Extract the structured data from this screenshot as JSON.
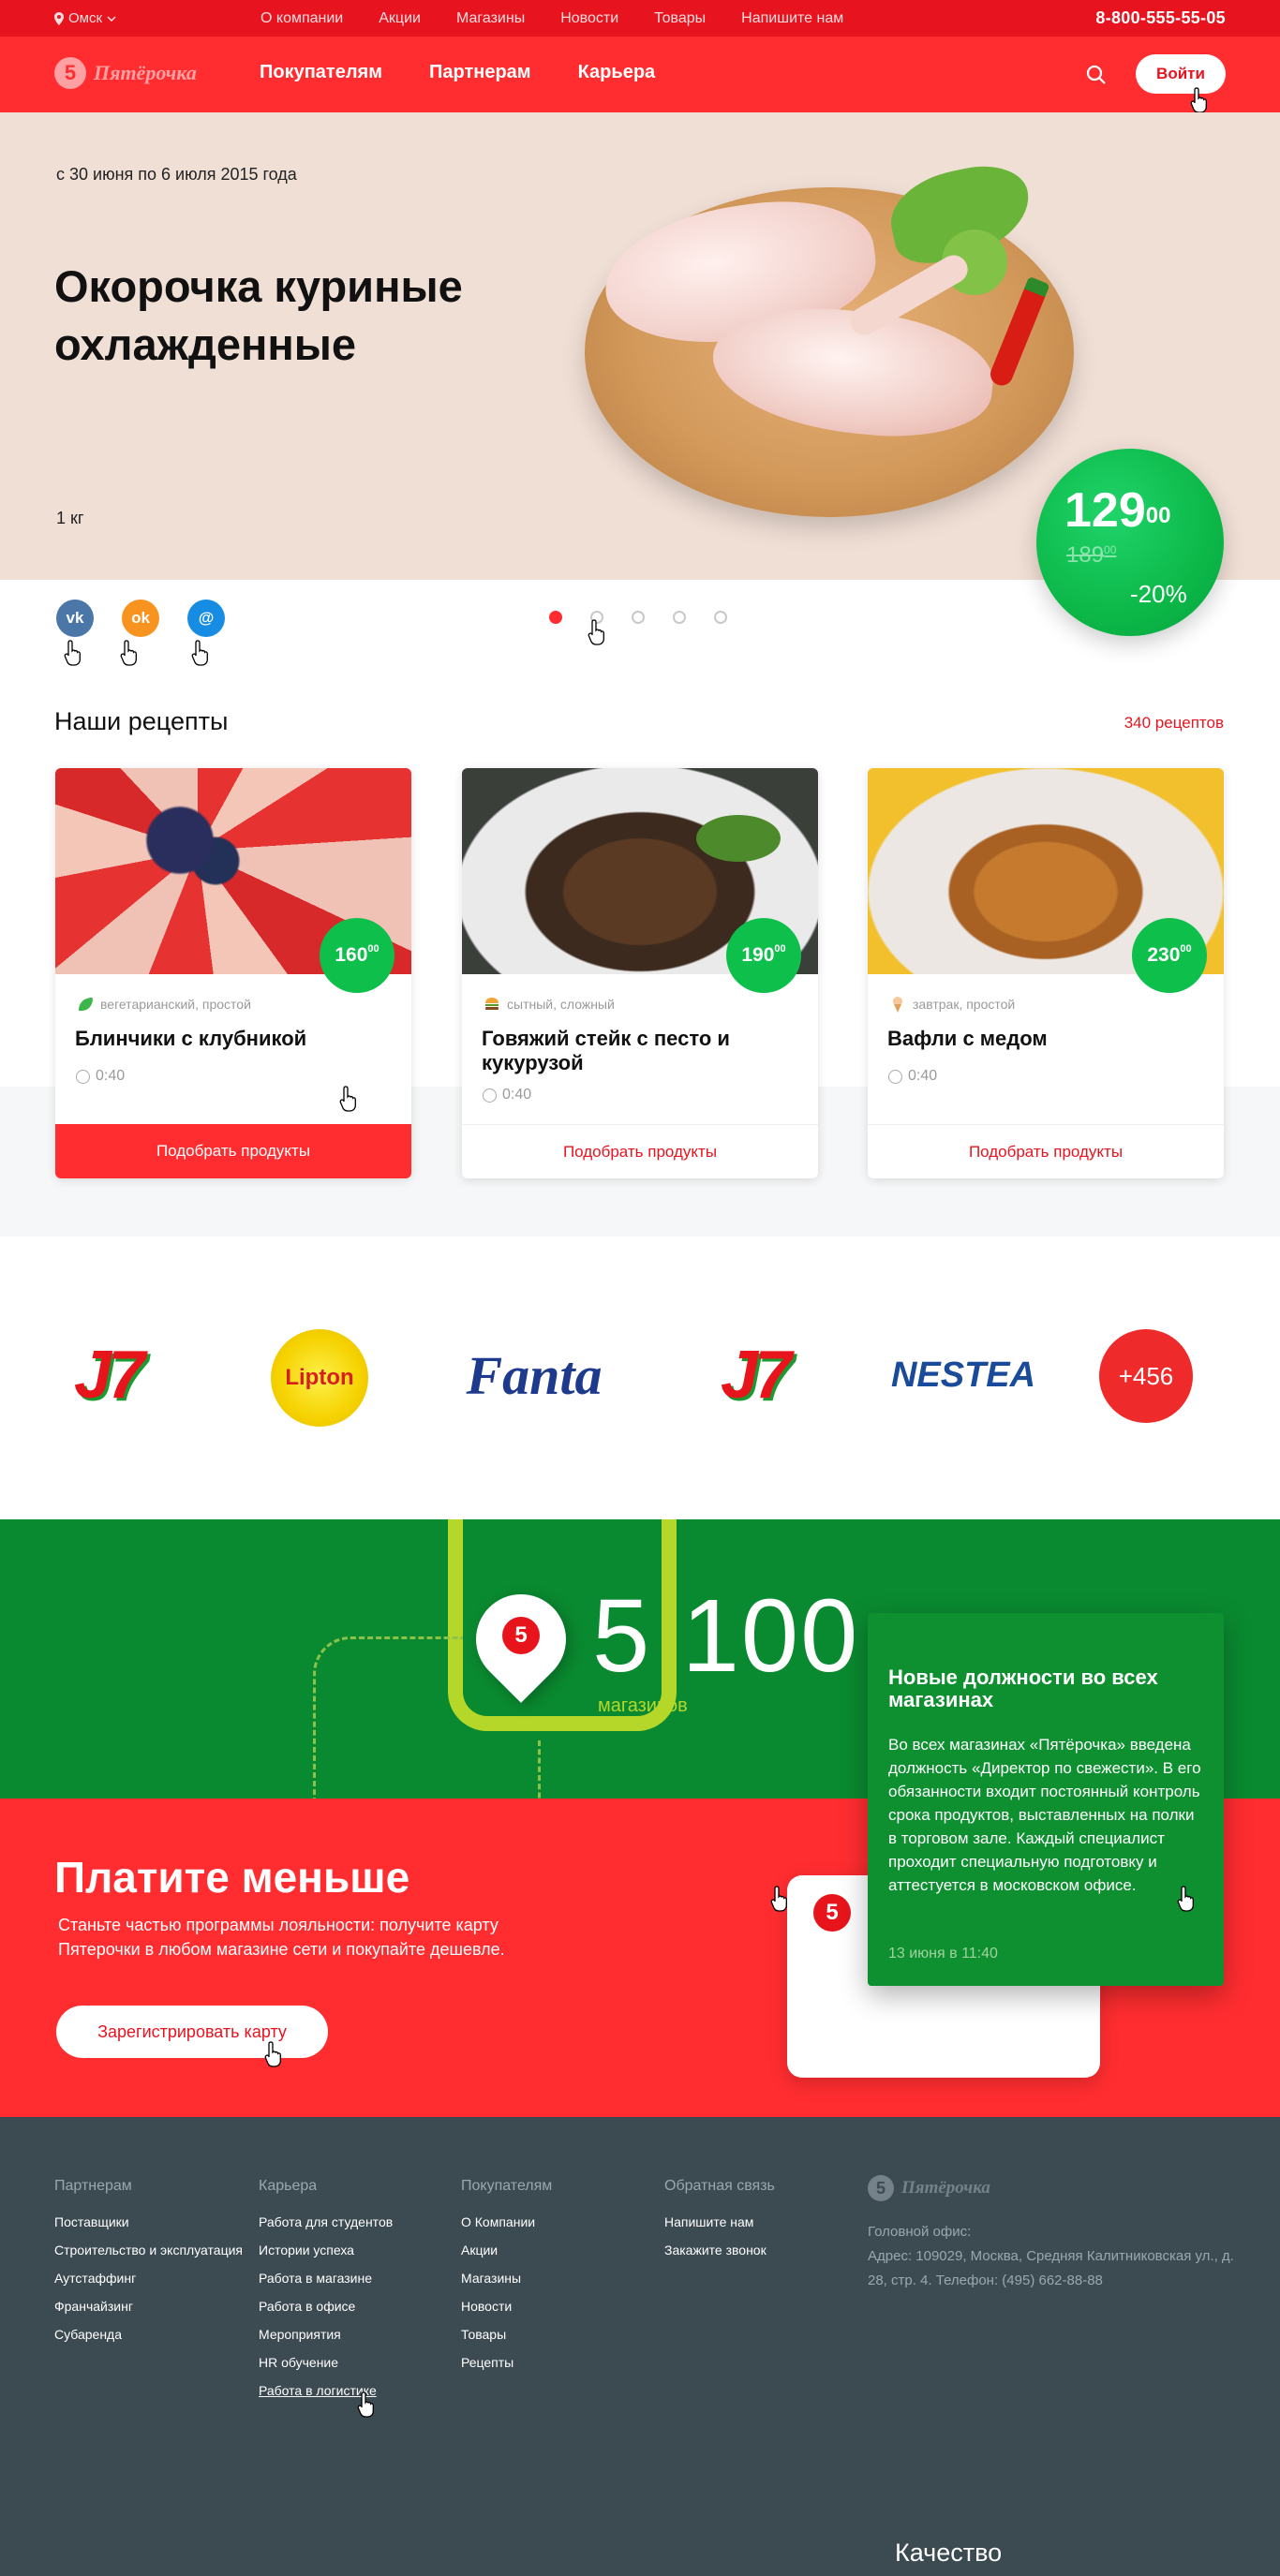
{
  "topbar": {
    "city": "Омск",
    "nav": [
      "О компании",
      "Акции",
      "Магазины",
      "Новости",
      "Товары",
      "Напишите нам"
    ],
    "phone": "8-800-555-55-05"
  },
  "header": {
    "logo_text": "Пятёрочка",
    "logo_mark": "5",
    "nav": [
      "Покупателям",
      "Партнерам",
      "Карьера"
    ],
    "login": "Войти"
  },
  "hero": {
    "date": "с 30 июня по 6 июля 2015 года",
    "title": "Окорочка куриные охлажденные",
    "weight": "1 кг",
    "price_main": "129",
    "price_cents": "00",
    "old_price_main": "189",
    "old_price_cents": "00",
    "discount": "-20%",
    "slides_total": 5,
    "slide_active": 1
  },
  "social": {
    "vk": "vk",
    "ok": "ok",
    "mail": "@"
  },
  "recipes": {
    "title": "Наши рецепты",
    "count": "340 рецептов",
    "items": [
      {
        "price": "160",
        "cents": "00",
        "tags": "вегетарианский, простой",
        "name": "Блинчики с клубникой",
        "time": "0:40",
        "button": "Подобрать продукты"
      },
      {
        "price": "190",
        "cents": "00",
        "tags": "сытный, сложный",
        "name": "Говяжий стейк с песто и кукурузой",
        "time": "0:40",
        "button": "Подобрать продукты"
      },
      {
        "price": "230",
        "cents": "00",
        "tags": "завтрак, простой",
        "name": "Вафли с медом",
        "time": "0:40",
        "button": "Подобрать продукты"
      }
    ]
  },
  "brands": {
    "items": [
      "J7",
      "Lipton",
      "Fanta",
      "J7",
      "NESTEA"
    ],
    "more": "+456"
  },
  "stores": {
    "number": "5 100",
    "label": "магазинов"
  },
  "news": {
    "title": "Новые должности во всех магазинах",
    "text": "Во всех магазинах «Пятёрочка» введена должность «Директор по свежести». В его обязанности входит постоянный контроль срока продуктов, выставленных на полки в торговом зале. Каждый специалист проходит специальную подготовку и аттестуется в московском офисе.",
    "date": "13 июня в 11:40"
  },
  "payless": {
    "title": "Платите меньше",
    "desc": "Станьте частью программы лояльности: получите карту Пятерочки в любом магазине сети и покупайте дешевле.",
    "button": "Зарегистрировать карту"
  },
  "footer": {
    "partners": {
      "title": "Партнерам",
      "links": [
        "Поставщики",
        "Строительство и эксплуатация",
        "Аутстаффинг",
        "Франчайзинг",
        "Субаренда"
      ]
    },
    "career": {
      "title": "Карьера",
      "links": [
        "Работа для студентов",
        "Истории успеха",
        "Работа в магазине",
        "Работа в офисе",
        "Мероприятия",
        "HR обучение",
        "Работа в логистике"
      ]
    },
    "customers": {
      "title": "Покупателям",
      "links": [
        "О Компании",
        "Акции",
        "Магазины",
        "Новости",
        "Товары",
        "Рецепты"
      ]
    },
    "feedback": {
      "title": "Обратная связь",
      "links": [
        "Напишите нам",
        "Закажите звонок"
      ]
    },
    "logo_text": "Пятёрочка",
    "logo_mark": "5",
    "office_label": "Головной офис:",
    "address": "Адрес: 109029, Москва, Средняя Калитниковская ул., д. 28, стр. 4. Телефон: (495) 662-88-88",
    "quality": "Качество"
  },
  "colors": {
    "brand_red": "#ff2d30",
    "brand_green": "#0a8a30",
    "price_green": "#0fbf4c",
    "footer_bg": "#3c4a52"
  }
}
